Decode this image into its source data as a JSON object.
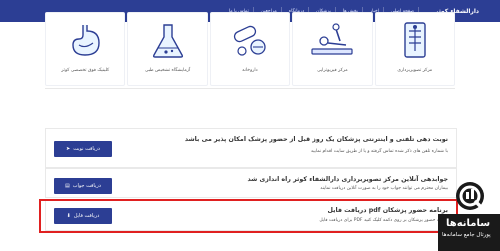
{
  "topbar": {
    "brand": "دارالشفاء کوثر",
    "nav": [
      "صفحه اصلی",
      "اخبار",
      "بخش ها",
      "پزشکان",
      "درمانگاه",
      "مراجعین",
      "تماس با ما"
    ]
  },
  "services": [
    {
      "label": "مرکز تصویربرداری"
    },
    {
      "label": "مرکز فیزیوتراپی"
    },
    {
      "label": "داروخانه"
    },
    {
      "label": "آزمایشگاه تشخیص طبی"
    },
    {
      "label": "کلینیک فوق تخصصی کوثر"
    }
  ],
  "panels": [
    {
      "title": "نوبت دهی تلفنی و اینترنتی پزشکان یک روز قبل از حضور پزشک امکان پذیر می باشد",
      "text": "با شماره تلفن های ذکر شده تماس گرفته و یا از طریق سایت اقدام نمایید",
      "text2": "",
      "button": "دریافت نوبت"
    },
    {
      "title": "جوابدهی آنلاین مرکز تصویربرداری دارالشفاء کوثر راه اندازی شد",
      "text": "بیماران محترم می توانند جواب خود را به صورت آنلاین دریافت نمایند",
      "text2": "",
      "button": "دریافت جواب"
    },
    {
      "title": "دریافت فایل pdf برنامه حضور پزشکان",
      "text": "برای دریافت فایل PDF برنامه حضور پزشکان بر روی دکمه کلیک کنید",
      "text2": "",
      "button": "دریافت فایل"
    }
  ],
  "logo": {
    "title": "سامانه‌ها",
    "subtitle": "پورتال جامع سامانه‌ها"
  }
}
